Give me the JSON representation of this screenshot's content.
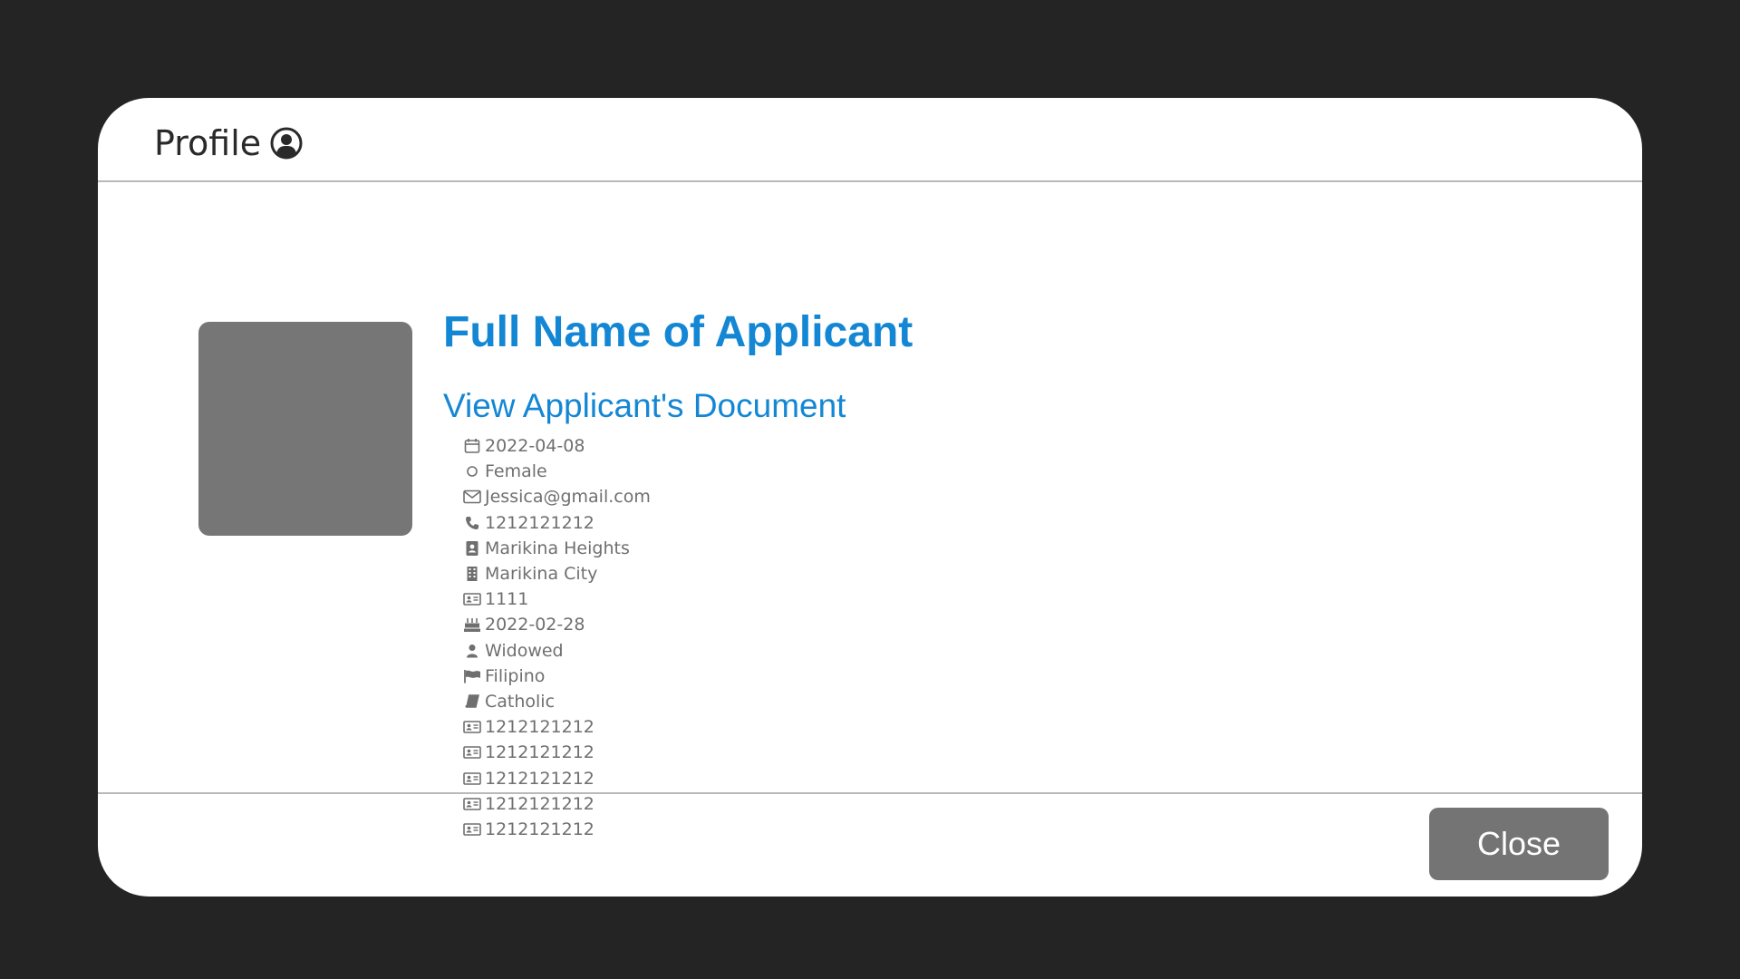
{
  "modal": {
    "title": "Profile",
    "title_icon": "user-circle-icon"
  },
  "applicant": {
    "name": "Full Name of Applicant",
    "document_link": "View Applicant's Document",
    "details": [
      {
        "icon": "calendar-icon",
        "value": "2022-04-08"
      },
      {
        "icon": "circle-icon",
        "value": "Female"
      },
      {
        "icon": "envelope-icon",
        "value": "Jessica@gmail.com"
      },
      {
        "icon": "phone-icon",
        "value": "1212121212"
      },
      {
        "icon": "address-book-icon",
        "value": "Marikina Heights"
      },
      {
        "icon": "building-icon",
        "value": "Marikina City"
      },
      {
        "icon": "id-card-icon",
        "value": "1111"
      },
      {
        "icon": "birthday-cake-icon",
        "value": "2022-02-28"
      },
      {
        "icon": "user-icon",
        "value": "Widowed"
      },
      {
        "icon": "flag-icon",
        "value": "Filipino"
      },
      {
        "icon": "book-icon",
        "value": "Catholic"
      },
      {
        "icon": "id-card-icon",
        "value": "1212121212"
      },
      {
        "icon": "id-card-icon",
        "value": "1212121212"
      },
      {
        "icon": "id-card-icon",
        "value": "1212121212"
      },
      {
        "icon": "id-card-icon",
        "value": "1212121212"
      },
      {
        "icon": "id-card-icon",
        "value": "1212121212"
      }
    ]
  },
  "footer": {
    "close_label": "Close"
  },
  "colors": {
    "backdrop": "#242424",
    "accent": "#1487d4",
    "detail_text": "#6f6f6f",
    "button": "#747474",
    "avatar": "#767676"
  }
}
